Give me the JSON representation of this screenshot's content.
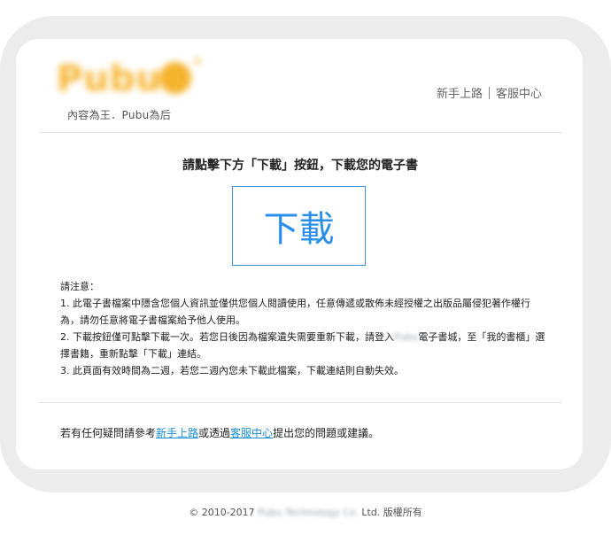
{
  "header": {
    "logo_text": "Pubu",
    "slogan": "內容為王．Pubu為后",
    "links": {
      "getting_started": "新手上路",
      "customer_service": "客服中心"
    }
  },
  "main": {
    "headline": "請點擊下方「下載」按鈕，下載您的電子書",
    "download_label": "下載",
    "notice": {
      "title": "請注意：",
      "item1": "1. 此電子書檔案中隱含您個人資訊並僅供您個人閱讀使用，任意傳遞或散佈未經授權之出版品屬侵犯著作權行為，請勿任意將電子書檔案給予他人使用。",
      "item2_before": "2. 下載按鈕僅可點擊下載一次。若您日後因為檔案遺失需要重新下載，請登入",
      "item2_blurred": "Pubu",
      "item2_after": "電子書城，至「我的書櫃」選擇書籍，重新點擊「下載」連結。",
      "item3": "3. 此頁面有效時間為二週，若您二週內您未下載此檔案，下載連結則自動失效。"
    }
  },
  "help": {
    "before": "若有任何疑問請參考",
    "link1": "新手上路",
    "middle": "或透過",
    "link2": "客服中心",
    "after": "提出您的問題或建議。"
  },
  "footer": {
    "copyright_prefix": "© 2010-2017",
    "company_blurred": "Pubu Technology Co.",
    "copyright_suffix": "Ltd. 版權所有"
  },
  "colors": {
    "accent_blue": "#2a8fe8",
    "link_blue": "#1a8fd6",
    "logo_orange": "#f6b32c"
  }
}
